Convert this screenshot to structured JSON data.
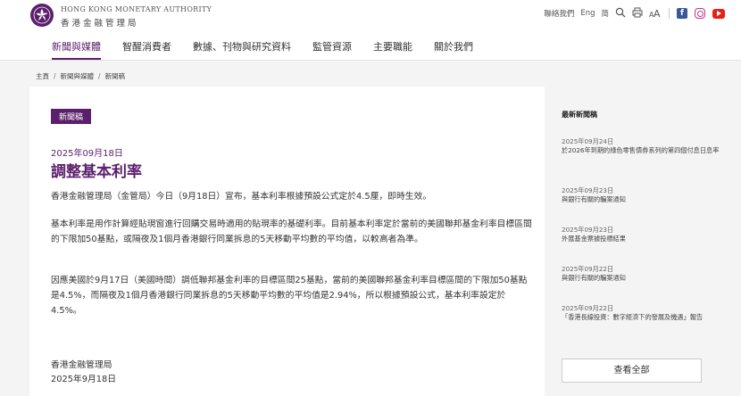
{
  "header": {
    "brand_en": "HONG KONG MONETARY AUTHORITY",
    "brand_zh": "香港金融管理局",
    "utility": {
      "contact": "聯絡我們",
      "eng": "Eng",
      "simplified": "简"
    }
  },
  "nav": {
    "items": [
      {
        "label": "新聞與媒體"
      },
      {
        "label": "智醒消費者"
      },
      {
        "label": "數據、刊物與研究資料"
      },
      {
        "label": "監管資源"
      },
      {
        "label": "主要職能"
      },
      {
        "label": "關於我們"
      }
    ]
  },
  "breadcrumb": {
    "items": [
      "主頁",
      "新聞與媒體",
      "新聞稿"
    ]
  },
  "article": {
    "tag": "新聞稿",
    "date": "2025年09月18日",
    "title": "調整基本利率",
    "paragraphs": [
      "香港金融管理局（金管局）今日（9月18日）宣布，基本利率根據預設公式定於4.5厘，即時生效。",
      "基本利率是用作計算經貼現窗進行回購交易時適用的貼現率的基礎利率。目前基本利率定於當前的美國聯邦基金利率目標區間的下限加50基點，或隔夜及1個月香港銀行同業拆息的5天移動平均數的平均值，以較高者為準。",
      "因應美國於9月17日（美國時間）調低聯邦基金利率的目標區間25基點，當前的美國聯邦基金利率目標區間的下限加50基點是4.5%，而隔夜及1個月香港銀行同業拆息的5天移動平均數的平均值是2.94%，所以根據預設公式，基本利率設定於4.5%。"
    ],
    "signature_org": "香港金融管理局",
    "signature_date": "2025年9月18日"
  },
  "sidebar": {
    "heading": "最新新聞稿",
    "items": [
      {
        "date": "2025年09月24日",
        "title": "於2026年到期的綠色零售債券系列的第四個付息日息率"
      },
      {
        "date": "2025年09月23日",
        "title": "與銀行有關的騙案通知"
      },
      {
        "date": "2025年09月23日",
        "title": "外匯基金票據投標結果"
      },
      {
        "date": "2025年09月22日",
        "title": "與銀行有關的騙案通知"
      },
      {
        "date": "2025年09月22日",
        "title": "「香港長線投資：數字經濟下的發展及機遇」報告"
      }
    ],
    "view_all": "查看全部"
  },
  "colors": {
    "brand": "#5b1f6b",
    "facebook": "#3b5998",
    "instagram": "#c13584",
    "youtube": "#e62117"
  },
  "icons": [
    "search-icon",
    "print-icon",
    "font-size-icon",
    "facebook-icon",
    "instagram-icon",
    "youtube-icon"
  ]
}
